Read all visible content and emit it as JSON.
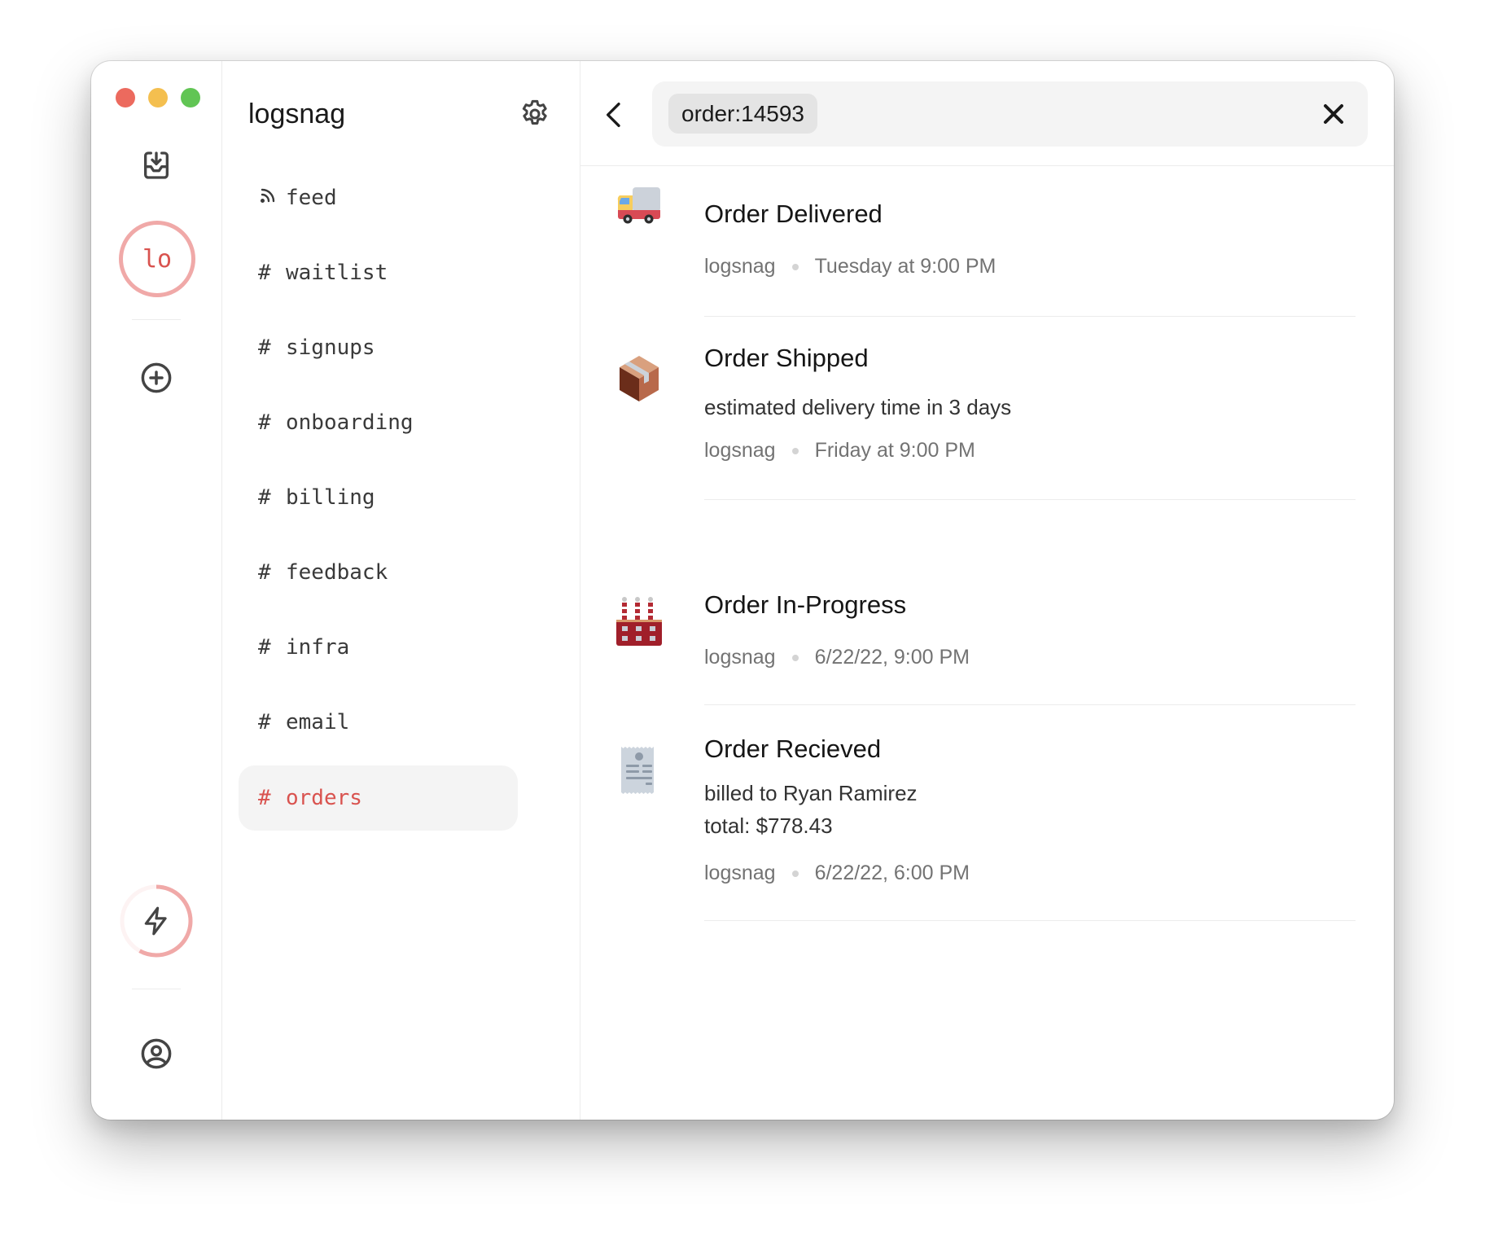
{
  "window": {
    "controls": {
      "close_color": "#ec6a5e",
      "minimize_color": "#f4bf4f",
      "maximize_color": "#61c554"
    }
  },
  "rail": {
    "inbox_icon": "inbox-download-icon",
    "project_avatar": {
      "label": "lo",
      "color": "#d9534f",
      "ring_color": "#f0a9a8"
    },
    "add_icon": "plus-circle-icon",
    "usage": {
      "icon": "lightning-icon",
      "progress_fraction": 0.58,
      "color": "#f0a9a8"
    },
    "account_icon": "user-circle-icon"
  },
  "sidebar": {
    "project_name": "logsnag",
    "settings_icon": "gear-icon",
    "channels": [
      {
        "label": "feed",
        "icon": "rss-icon",
        "active": false
      },
      {
        "label": "waitlist",
        "icon": "#",
        "active": false
      },
      {
        "label": "signups",
        "icon": "#",
        "active": false
      },
      {
        "label": "onboarding",
        "icon": "#",
        "active": false
      },
      {
        "label": "billing",
        "icon": "#",
        "active": false
      },
      {
        "label": "feedback",
        "icon": "#",
        "active": false
      },
      {
        "label": "infra",
        "icon": "#",
        "active": false
      },
      {
        "label": "email",
        "icon": "#",
        "active": false
      },
      {
        "label": "orders",
        "icon": "#",
        "active": true
      }
    ],
    "accent_color": "#d9534f"
  },
  "search": {
    "back_icon": "chevron-left-icon",
    "query_tag": "order:14593",
    "clear_icon": "close-icon"
  },
  "events": [
    {
      "icon": "delivery-truck-icon",
      "title": "Order Delivered",
      "description": [],
      "project": "logsnag",
      "time": "Tuesday at 9:00 PM"
    },
    {
      "icon": "package-icon",
      "title": "Order Shipped",
      "description": [
        "estimated delivery time in 3 days"
      ],
      "project": "logsnag",
      "time": "Friday at 9:00 PM"
    },
    {
      "icon": "factory-icon",
      "title": "Order In-Progress",
      "description": [],
      "project": "logsnag",
      "time": "6/22/22, 9:00 PM"
    },
    {
      "icon": "receipt-icon",
      "title": "Order Recieved",
      "description": [
        "billed to Ryan Ramirez",
        "total: $778.43"
      ],
      "project": "logsnag",
      "time": "6/22/22, 6:00 PM"
    }
  ]
}
